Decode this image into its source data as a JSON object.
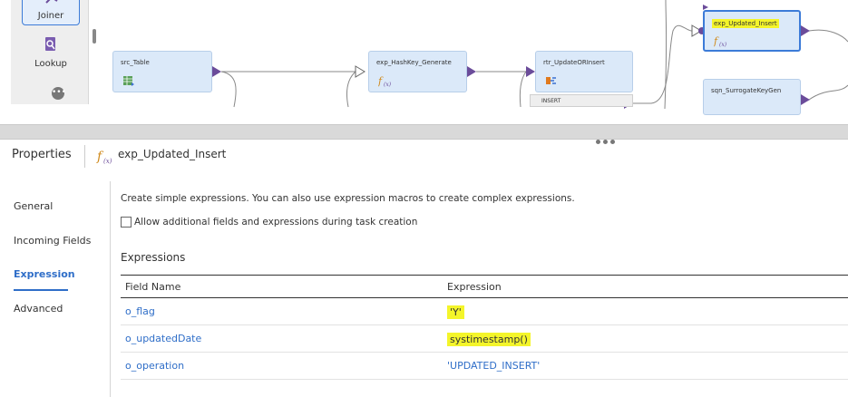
{
  "palette": {
    "joiner_label": "Joiner",
    "lookup_label": "Lookup"
  },
  "canvas": {
    "nodes": [
      {
        "name": "src_Table",
        "icon": "table-icon"
      },
      {
        "name": "exp_HashKey_Generate",
        "icon": "expression-fx-icon"
      },
      {
        "name": "rtr_UpdateORInsert",
        "icon": "router-icon"
      },
      {
        "name": "exp_Updated_Insert",
        "icon": "expression-fx-icon",
        "selected": true
      },
      {
        "name": "sqn_SurrogateKeyGen",
        "icon": ""
      }
    ],
    "router_group": "INSERT"
  },
  "properties": {
    "title": "Properties",
    "object_name": "exp_Updated_Insert"
  },
  "tabs": {
    "general": "General",
    "incoming": "Incoming Fields",
    "expression": "Expression",
    "advanced": "Advanced"
  },
  "content": {
    "description": "Create simple expressions. You can also use expression macros to create complex expressions.",
    "allow_checkbox_label": "Allow additional fields and expressions during task creation",
    "allow_checked": false,
    "expressions_title": "Expressions"
  },
  "table": {
    "headers": [
      "Field Name",
      "Expression"
    ],
    "rows": [
      {
        "field": "o_flag",
        "expression": "'Y'"
      },
      {
        "field": "o_updatedDate",
        "expression": "systimestamp()"
      },
      {
        "field": "o_operation",
        "expression": "'UPDATED_INSERT'"
      }
    ]
  },
  "colors": {
    "accent": "#2f6ec8",
    "highlight": "#f4f52a",
    "node_fill": "#dbe9f9",
    "port": "#6b4c9a"
  }
}
